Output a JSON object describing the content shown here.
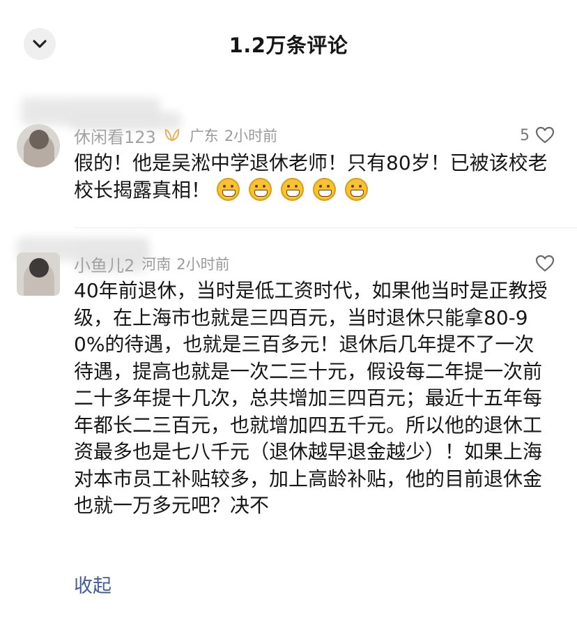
{
  "header": {
    "title": "1.2万条评论"
  },
  "comments": [
    {
      "username": "休闲看123",
      "location": "广东",
      "time": "2小时前",
      "likes": "5",
      "text": "假的！他是吴淞中学退休老师！只有80岁！已被该校老校长揭露真相！",
      "emoji_count": 5,
      "emoji_icon": "grin-emoji-icon"
    },
    {
      "username": "小鱼儿2",
      "location": "河南",
      "time": "2小时前",
      "likes": "",
      "text": "40年前退休，当时是低工资时代，如果他当时是正教授级，在上海市也就是三四百元，当时退休只能拿80-90%的待遇，也就是三百多元！退休后几年提不了一次待遇，提高也就是一次二三十元，假设每二年提一次前二十多年提十几次，总共增加三四百元；最近十五年每年都长二三百元，也就增加四五千元。所以他的退休工资最多也是七八千元（退休越早退金越少）！如果上海对本市员工补贴较多，加上高龄补贴，他的目前退休金也就一万多元吧？决不",
      "collapse_label": "收起"
    }
  ],
  "colors": {
    "link": "#3f5f96",
    "meta": "#9a9a9a",
    "text": "#161616"
  }
}
